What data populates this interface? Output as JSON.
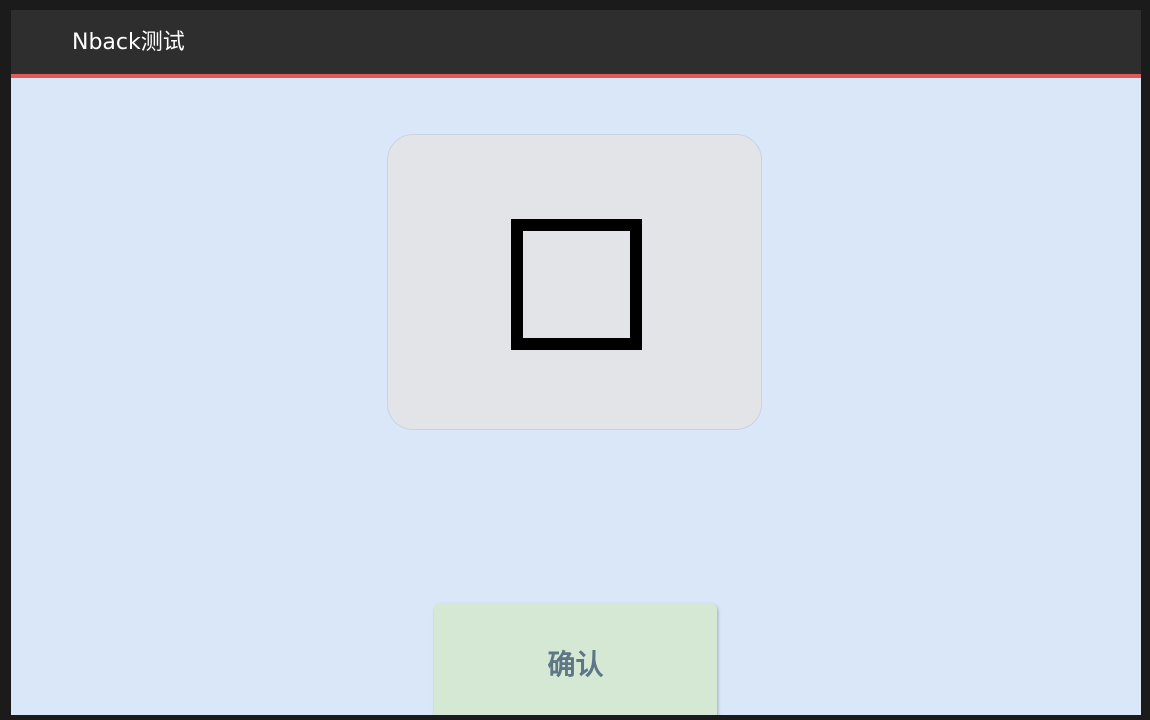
{
  "app": {
    "title": "Nback测试"
  },
  "stimulus": {
    "icon": "square-outline-icon"
  },
  "actions": {
    "confirm_label": "确认"
  },
  "colors": {
    "appbar": "#2e2e2e",
    "appbar_accent": "#e05a5a",
    "background": "#d9e7f8",
    "card": "#e3e4e8",
    "confirm_button": "#d5e8d4",
    "confirm_text": "#5e7686"
  }
}
